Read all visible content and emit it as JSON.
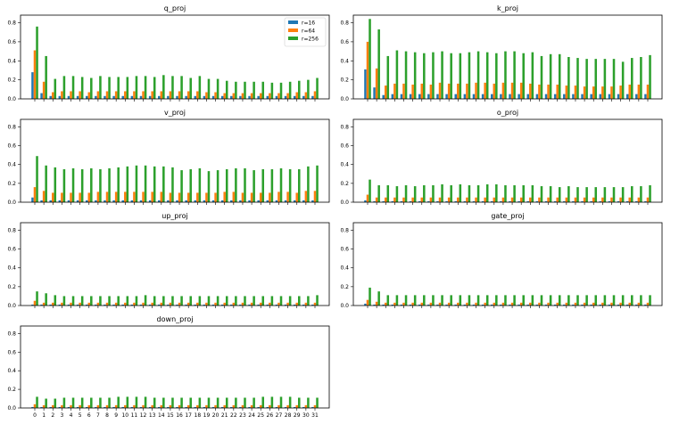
{
  "chart_data": [
    {
      "type": "bar",
      "title": "q_proj",
      "ylim": [
        0,
        0.88
      ],
      "yticks": [
        "0.0",
        "0.2",
        "0.4",
        "0.6",
        "0.8"
      ],
      "show_xticks": false,
      "legend": "top-right",
      "series": [
        {
          "name": "r=16",
          "values": [
            0.28,
            0.06,
            0.03,
            0.03,
            0.03,
            0.03,
            0.03,
            0.03,
            0.03,
            0.03,
            0.03,
            0.03,
            0.03,
            0.03,
            0.03,
            0.03,
            0.03,
            0.03,
            0.03,
            0.03,
            0.03,
            0.03,
            0.03,
            0.03,
            0.03,
            0.03,
            0.03,
            0.03,
            0.03,
            0.03,
            0.03,
            0.03
          ]
        },
        {
          "name": "r=64",
          "values": [
            0.51,
            0.18,
            0.07,
            0.08,
            0.08,
            0.08,
            0.07,
            0.08,
            0.08,
            0.08,
            0.08,
            0.08,
            0.08,
            0.08,
            0.08,
            0.08,
            0.08,
            0.08,
            0.08,
            0.07,
            0.07,
            0.06,
            0.06,
            0.06,
            0.06,
            0.06,
            0.06,
            0.06,
            0.06,
            0.07,
            0.07,
            0.08
          ]
        },
        {
          "name": "r=256",
          "values": [
            0.76,
            0.45,
            0.21,
            0.24,
            0.24,
            0.23,
            0.22,
            0.24,
            0.23,
            0.23,
            0.23,
            0.24,
            0.24,
            0.23,
            0.25,
            0.24,
            0.24,
            0.22,
            0.24,
            0.21,
            0.21,
            0.19,
            0.18,
            0.18,
            0.18,
            0.18,
            0.17,
            0.17,
            0.18,
            0.19,
            0.2,
            0.22
          ]
        }
      ]
    },
    {
      "type": "bar",
      "title": "k_proj",
      "ylim": [
        0,
        0.88
      ],
      "yticks": [
        "0.0",
        "0.2",
        "0.4",
        "0.6",
        "0.8"
      ],
      "show_xticks": false,
      "series": [
        {
          "name": "r=16",
          "values": [
            0.31,
            0.12,
            0.04,
            0.05,
            0.05,
            0.05,
            0.05,
            0.05,
            0.05,
            0.05,
            0.05,
            0.05,
            0.05,
            0.05,
            0.05,
            0.05,
            0.05,
            0.05,
            0.05,
            0.05,
            0.05,
            0.05,
            0.05,
            0.05,
            0.05,
            0.05,
            0.05,
            0.05,
            0.05,
            0.05,
            0.05,
            0.05
          ]
        },
        {
          "name": "r=64",
          "values": [
            0.6,
            0.32,
            0.14,
            0.16,
            0.16,
            0.15,
            0.16,
            0.15,
            0.17,
            0.16,
            0.16,
            0.16,
            0.17,
            0.17,
            0.16,
            0.17,
            0.17,
            0.17,
            0.16,
            0.15,
            0.15,
            0.15,
            0.14,
            0.14,
            0.13,
            0.13,
            0.13,
            0.13,
            0.14,
            0.15,
            0.15,
            0.15
          ]
        },
        {
          "name": "r=256",
          "values": [
            0.84,
            0.73,
            0.45,
            0.51,
            0.5,
            0.49,
            0.48,
            0.49,
            0.5,
            0.48,
            0.48,
            0.49,
            0.5,
            0.49,
            0.48,
            0.5,
            0.5,
            0.48,
            0.49,
            0.45,
            0.47,
            0.47,
            0.44,
            0.43,
            0.42,
            0.42,
            0.42,
            0.42,
            0.39,
            0.43,
            0.44,
            0.46
          ]
        }
      ]
    },
    {
      "type": "bar",
      "title": "v_proj",
      "ylim": [
        0,
        0.88
      ],
      "yticks": [
        "0.0",
        "0.2",
        "0.4",
        "0.6",
        "0.8"
      ],
      "show_xticks": false,
      "series": [
        {
          "name": "r=16",
          "values": [
            0.05,
            0.02,
            0.02,
            0.02,
            0.02,
            0.02,
            0.02,
            0.02,
            0.02,
            0.02,
            0.02,
            0.02,
            0.02,
            0.02,
            0.02,
            0.02,
            0.02,
            0.02,
            0.02,
            0.02,
            0.02,
            0.02,
            0.02,
            0.02,
            0.02,
            0.02,
            0.02,
            0.02,
            0.02,
            0.02,
            0.02,
            0.02
          ]
        },
        {
          "name": "r=64",
          "values": [
            0.16,
            0.12,
            0.1,
            0.1,
            0.1,
            0.1,
            0.1,
            0.11,
            0.11,
            0.11,
            0.11,
            0.11,
            0.11,
            0.11,
            0.11,
            0.1,
            0.1,
            0.1,
            0.1,
            0.1,
            0.1,
            0.11,
            0.11,
            0.1,
            0.1,
            0.1,
            0.1,
            0.11,
            0.11,
            0.1,
            0.12,
            0.12
          ]
        },
        {
          "name": "r=256",
          "values": [
            0.49,
            0.39,
            0.37,
            0.35,
            0.36,
            0.35,
            0.36,
            0.35,
            0.36,
            0.37,
            0.38,
            0.39,
            0.39,
            0.38,
            0.38,
            0.37,
            0.34,
            0.35,
            0.36,
            0.33,
            0.34,
            0.35,
            0.36,
            0.36,
            0.34,
            0.35,
            0.35,
            0.36,
            0.35,
            0.35,
            0.38,
            0.39
          ]
        }
      ]
    },
    {
      "type": "bar",
      "title": "o_proj",
      "ylim": [
        0,
        0.88
      ],
      "yticks": [
        "0.0",
        "0.2",
        "0.4",
        "0.6",
        "0.8"
      ],
      "show_xticks": false,
      "series": [
        {
          "name": "r=16",
          "values": [
            0.02,
            0.01,
            0.01,
            0.01,
            0.01,
            0.01,
            0.01,
            0.01,
            0.01,
            0.01,
            0.01,
            0.01,
            0.01,
            0.01,
            0.01,
            0.01,
            0.01,
            0.01,
            0.01,
            0.01,
            0.01,
            0.01,
            0.01,
            0.01,
            0.01,
            0.01,
            0.01,
            0.01,
            0.01,
            0.01,
            0.01,
            0.01
          ]
        },
        {
          "name": "r=64",
          "values": [
            0.08,
            0.05,
            0.05,
            0.05,
            0.05,
            0.05,
            0.05,
            0.05,
            0.05,
            0.05,
            0.05,
            0.05,
            0.05,
            0.05,
            0.05,
            0.05,
            0.05,
            0.05,
            0.05,
            0.05,
            0.05,
            0.05,
            0.05,
            0.05,
            0.05,
            0.05,
            0.05,
            0.05,
            0.05,
            0.05,
            0.05,
            0.05
          ]
        },
        {
          "name": "r=256",
          "values": [
            0.24,
            0.18,
            0.18,
            0.17,
            0.18,
            0.17,
            0.18,
            0.18,
            0.19,
            0.18,
            0.19,
            0.18,
            0.18,
            0.19,
            0.19,
            0.18,
            0.18,
            0.18,
            0.18,
            0.17,
            0.17,
            0.16,
            0.17,
            0.16,
            0.16,
            0.16,
            0.16,
            0.16,
            0.16,
            0.17,
            0.17,
            0.18
          ]
        }
      ]
    },
    {
      "type": "bar",
      "title": "up_proj",
      "ylim": [
        0,
        0.88
      ],
      "yticks": [
        "0.0",
        "0.2",
        "0.4",
        "0.6",
        "0.8"
      ],
      "show_xticks": false,
      "series": [
        {
          "name": "r=16",
          "values": [
            0.01,
            0.01,
            0.01,
            0.01,
            0.01,
            0.01,
            0.01,
            0.01,
            0.01,
            0.01,
            0.01,
            0.01,
            0.01,
            0.01,
            0.01,
            0.01,
            0.01,
            0.01,
            0.01,
            0.01,
            0.01,
            0.01,
            0.01,
            0.01,
            0.01,
            0.01,
            0.01,
            0.01,
            0.01,
            0.01,
            0.01,
            0.01
          ]
        },
        {
          "name": "r=64",
          "values": [
            0.05,
            0.03,
            0.03,
            0.03,
            0.03,
            0.03,
            0.03,
            0.03,
            0.03,
            0.03,
            0.03,
            0.03,
            0.03,
            0.03,
            0.03,
            0.03,
            0.03,
            0.03,
            0.03,
            0.03,
            0.03,
            0.03,
            0.03,
            0.03,
            0.03,
            0.03,
            0.03,
            0.03,
            0.03,
            0.03,
            0.03,
            0.03
          ]
        },
        {
          "name": "r=256",
          "values": [
            0.15,
            0.13,
            0.11,
            0.1,
            0.1,
            0.1,
            0.1,
            0.1,
            0.1,
            0.1,
            0.1,
            0.1,
            0.11,
            0.1,
            0.1,
            0.1,
            0.1,
            0.1,
            0.1,
            0.1,
            0.1,
            0.1,
            0.1,
            0.1,
            0.1,
            0.1,
            0.1,
            0.1,
            0.1,
            0.1,
            0.1,
            0.11
          ]
        }
      ]
    },
    {
      "type": "bar",
      "title": "gate_proj",
      "ylim": [
        0,
        0.88
      ],
      "yticks": [
        "0.0",
        "0.2",
        "0.4",
        "0.6",
        "0.8"
      ],
      "show_xticks": false,
      "series": [
        {
          "name": "r=16",
          "values": [
            0.02,
            0.01,
            0.01,
            0.01,
            0.01,
            0.01,
            0.01,
            0.01,
            0.01,
            0.01,
            0.01,
            0.01,
            0.01,
            0.01,
            0.01,
            0.01,
            0.01,
            0.01,
            0.01,
            0.01,
            0.01,
            0.01,
            0.01,
            0.01,
            0.01,
            0.01,
            0.01,
            0.01,
            0.01,
            0.01,
            0.01,
            0.01
          ]
        },
        {
          "name": "r=64",
          "values": [
            0.06,
            0.04,
            0.03,
            0.03,
            0.03,
            0.03,
            0.03,
            0.03,
            0.03,
            0.03,
            0.03,
            0.03,
            0.03,
            0.03,
            0.03,
            0.03,
            0.03,
            0.03,
            0.03,
            0.03,
            0.03,
            0.03,
            0.03,
            0.03,
            0.03,
            0.03,
            0.03,
            0.03,
            0.03,
            0.03,
            0.03,
            0.03
          ]
        },
        {
          "name": "r=256",
          "values": [
            0.19,
            0.15,
            0.11,
            0.11,
            0.11,
            0.11,
            0.11,
            0.11,
            0.11,
            0.11,
            0.11,
            0.11,
            0.11,
            0.11,
            0.11,
            0.11,
            0.11,
            0.11,
            0.11,
            0.11,
            0.11,
            0.11,
            0.11,
            0.11,
            0.11,
            0.11,
            0.11,
            0.11,
            0.11,
            0.11,
            0.11,
            0.11
          ]
        }
      ]
    },
    {
      "type": "bar",
      "title": "down_proj",
      "ylim": [
        0,
        0.88
      ],
      "yticks": [
        "0.0",
        "0.2",
        "0.4",
        "0.6",
        "0.8"
      ],
      "show_xticks": true,
      "categories": [
        "0",
        "1",
        "2",
        "3",
        "4",
        "5",
        "6",
        "7",
        "8",
        "9",
        "10",
        "11",
        "12",
        "13",
        "14",
        "15",
        "16",
        "17",
        "18",
        "19",
        "20",
        "21",
        "22",
        "23",
        "24",
        "25",
        "26",
        "27",
        "28",
        "29",
        "30",
        "31"
      ],
      "series": [
        {
          "name": "r=16",
          "values": [
            0.01,
            0.01,
            0.01,
            0.01,
            0.01,
            0.01,
            0.01,
            0.01,
            0.01,
            0.01,
            0.01,
            0.01,
            0.01,
            0.01,
            0.01,
            0.01,
            0.01,
            0.01,
            0.01,
            0.01,
            0.01,
            0.01,
            0.01,
            0.01,
            0.01,
            0.01,
            0.01,
            0.01,
            0.01,
            0.01,
            0.01,
            0.01
          ]
        },
        {
          "name": "r=64",
          "values": [
            0.04,
            0.03,
            0.03,
            0.03,
            0.03,
            0.03,
            0.03,
            0.03,
            0.03,
            0.03,
            0.03,
            0.03,
            0.03,
            0.03,
            0.03,
            0.03,
            0.03,
            0.03,
            0.03,
            0.03,
            0.03,
            0.03,
            0.03,
            0.03,
            0.03,
            0.03,
            0.03,
            0.03,
            0.03,
            0.03,
            0.03,
            0.03
          ]
        },
        {
          "name": "r=256",
          "values": [
            0.12,
            0.1,
            0.1,
            0.11,
            0.11,
            0.11,
            0.11,
            0.11,
            0.11,
            0.12,
            0.12,
            0.12,
            0.12,
            0.11,
            0.11,
            0.11,
            0.11,
            0.11,
            0.11,
            0.11,
            0.11,
            0.11,
            0.11,
            0.11,
            0.11,
            0.12,
            0.12,
            0.12,
            0.12,
            0.11,
            0.11,
            0.11
          ]
        }
      ]
    }
  ],
  "legend": {
    "entries": [
      {
        "label": "r=16",
        "color": "#1f77b4"
      },
      {
        "label": "r=64",
        "color": "#ff7f0e"
      },
      {
        "label": "r=256",
        "color": "#2ca02c"
      }
    ]
  }
}
